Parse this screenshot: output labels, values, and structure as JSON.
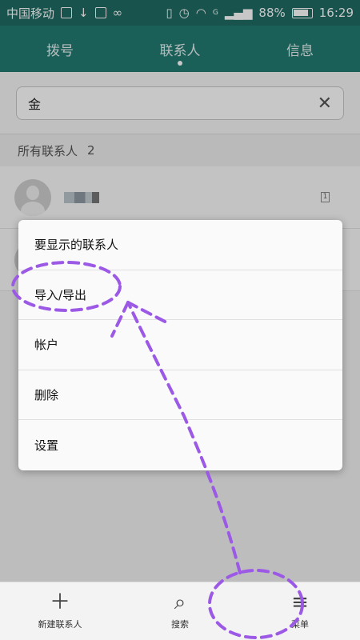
{
  "status_bar": {
    "carrier": "中国移动",
    "battery": "88%",
    "time": "16:29",
    "network_label": "G"
  },
  "tabs": [
    {
      "label": "拨号"
    },
    {
      "label": "联系人"
    },
    {
      "label": "信息"
    }
  ],
  "search": {
    "value": "金",
    "clear_icon": "close-icon"
  },
  "section": {
    "title": "所有联系人",
    "count": "2"
  },
  "contacts": [
    {
      "sim_badge": "1"
    }
  ],
  "menu": {
    "items": [
      {
        "label": "要显示的联系人"
      },
      {
        "label": "导入/导出"
      },
      {
        "label": "帐户"
      },
      {
        "label": "删除"
      },
      {
        "label": "设置"
      }
    ]
  },
  "bottom_bar": {
    "items": [
      {
        "label": "新建联系人",
        "icon": "plus-icon"
      },
      {
        "label": "搜索",
        "icon": "search-icon"
      },
      {
        "label": "菜单",
        "icon": "menu-icon"
      }
    ]
  },
  "colors": {
    "status_bar": "#1f6b64",
    "tab_bar": "#237a72",
    "annotation": "#9b59e6"
  }
}
